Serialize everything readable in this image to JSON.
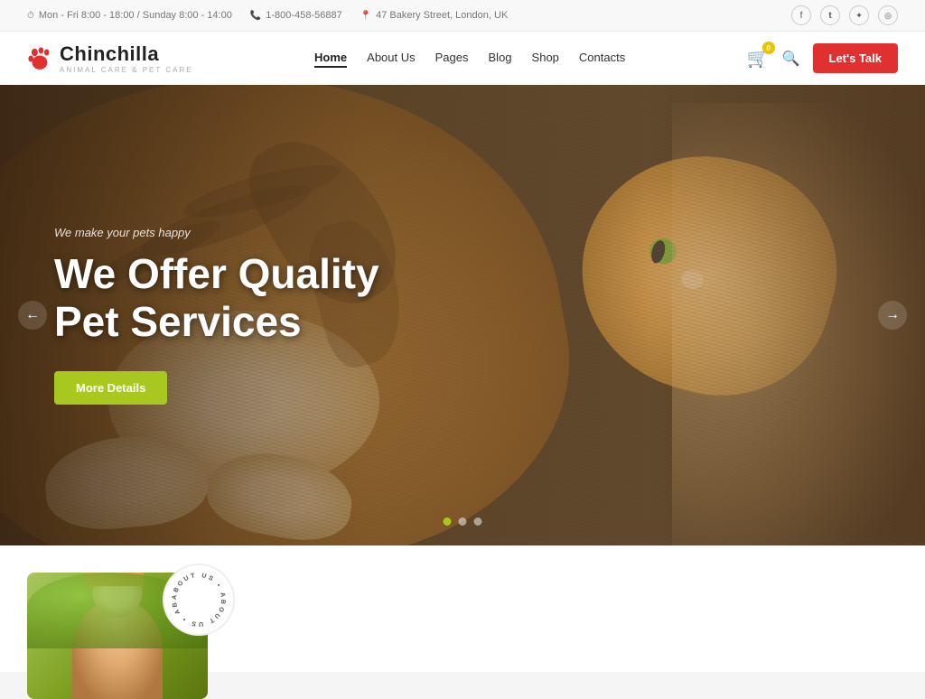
{
  "topbar": {
    "schedule": "Mon - Fri 8:00 - 18:00 / Sunday 8:00 - 14:00",
    "phone": "1-800-458-56887",
    "address": "47 Bakery Street, London, UK"
  },
  "header": {
    "logo_title": "Chinchilla",
    "logo_subtitle": "Animal Care & Pet Care",
    "nav": [
      {
        "label": "Home",
        "active": true
      },
      {
        "label": "About Us",
        "active": false
      },
      {
        "label": "Pages",
        "active": false
      },
      {
        "label": "Blog",
        "active": false
      },
      {
        "label": "Shop",
        "active": false
      },
      {
        "label": "Contacts",
        "active": false
      }
    ],
    "cart_count": "0",
    "talk_button": "Let's Talk"
  },
  "hero": {
    "tagline": "We make your pets happy",
    "title": "We Offer Quality Pet Services",
    "cta_button": "More Details",
    "dots": [
      true,
      false,
      false
    ]
  },
  "below_hero": {
    "about_badge_text": "ABOUT US"
  },
  "social": [
    {
      "icon": "facebook-icon",
      "symbol": "f"
    },
    {
      "icon": "twitter-icon",
      "symbol": "t"
    },
    {
      "icon": "star-icon",
      "symbol": "✦"
    },
    {
      "icon": "instagram-icon",
      "symbol": "◎"
    }
  ]
}
